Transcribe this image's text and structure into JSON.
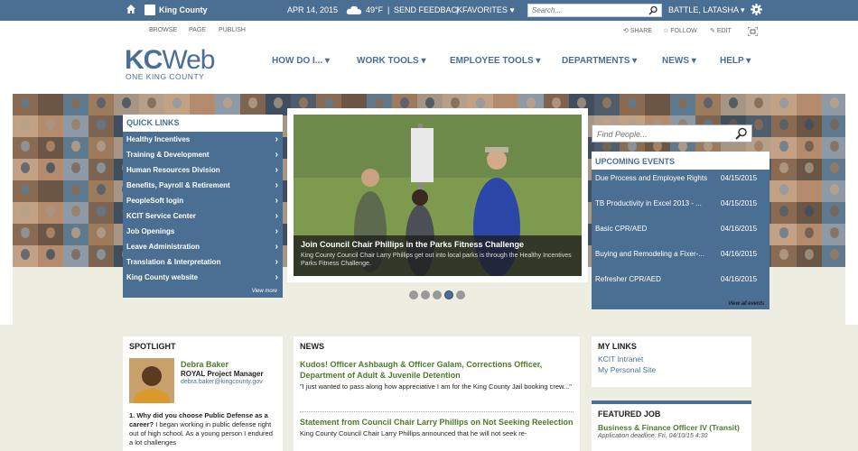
{
  "topbar": {
    "site": "King County",
    "date": "APR 14, 2015",
    "temperature": "49°F",
    "send_feedback": "SEND FEEDBACK",
    "favorites": "FAVORITES",
    "search_placeholder": "Search...",
    "user": "BATTLE, LATASHA"
  },
  "ribbon": {
    "tabs": [
      "BROWSE",
      "PAGE",
      "PUBLISH"
    ],
    "tools": [
      "SHARE",
      "FOLLOW",
      "EDIT"
    ]
  },
  "logo": {
    "kc": "KC",
    "web": "Web",
    "sub": "ONE KING COUNTY"
  },
  "nav": [
    "HOW DO I...",
    "WORK TOOLS",
    "EMPLOYEE TOOLS",
    "DEPARTMENTS",
    "NEWS",
    "HELP"
  ],
  "quick_links": {
    "title": "QUICK LINKS",
    "items": [
      "Healthy Incentives",
      "Training & Development",
      "Human Resources Division",
      "Benefits, Payroll & Retirement",
      "PeopleSoft login",
      "KCIT Service Center",
      "Job Openings",
      "Leave Administration",
      "Translation & Interpretation",
      "King County website"
    ],
    "more": "View more"
  },
  "feature": {
    "title": "Join Council Chair Phillips in the Parks Fitness Challenge",
    "desc": "King County Council Chair Larry Phillips get out into local parks is through the Healthy Incentives Parks Fitness Challenge.",
    "slides": 5,
    "active_slide": 4
  },
  "find_people": {
    "placeholder": "Find People..."
  },
  "events": {
    "title": "UPCOMING EVENTS",
    "items": [
      {
        "name": "Due Process and Employee Rights",
        "date": "04/15/2015"
      },
      {
        "name": "TB Productivity in Excel 2013 - ...",
        "date": "04/15/2015"
      },
      {
        "name": "Basic CPR/AED",
        "date": "04/16/2015"
      },
      {
        "name": "Buying and Remodeling a Fixer-...",
        "date": "04/16/2015"
      },
      {
        "name": "Refresher CPR/AED",
        "date": "04/16/2015"
      }
    ],
    "more": "View all events"
  },
  "spotlight": {
    "title": "SPOTLIGHT",
    "name": "Debra Baker",
    "role": "ROYAL Project Manager",
    "email": "debra.baker@kingcounty.gov",
    "q_label": "1. Why did you choose Public Defense as a career?",
    "q_text": " I began working in public defense right out of high school. As a young person I endured a lot challenges"
  },
  "news": {
    "title": "NEWS",
    "items": [
      {
        "headline": "Kudos! Officer Ashbaugh & Officer Galam, Corrections Officer, Department of Adult & Juvenile Detention",
        "body": "\"I just wanted to pass along how appreciative I am for the King County Jail booking crew...\""
      },
      {
        "headline": "Statement from Council Chair Larry Phillips on Not Seeking Reelection",
        "body": "King County Council Chair Larry Phillips announced that he will not seek re-"
      }
    ]
  },
  "my_links": {
    "title": "MY LINKS",
    "items": [
      "KCIT Intranet",
      "My Personal Site"
    ]
  },
  "featured_job": {
    "title": "FEATURED JOB",
    "job": "Business & Finance Officer IV (Transit)",
    "deadline": "Application deadline: Fri, 04/10/15 4:30"
  },
  "colors": {
    "brand": "#4b6f93",
    "green": "#4f7a2c",
    "background": "#eeede2"
  }
}
